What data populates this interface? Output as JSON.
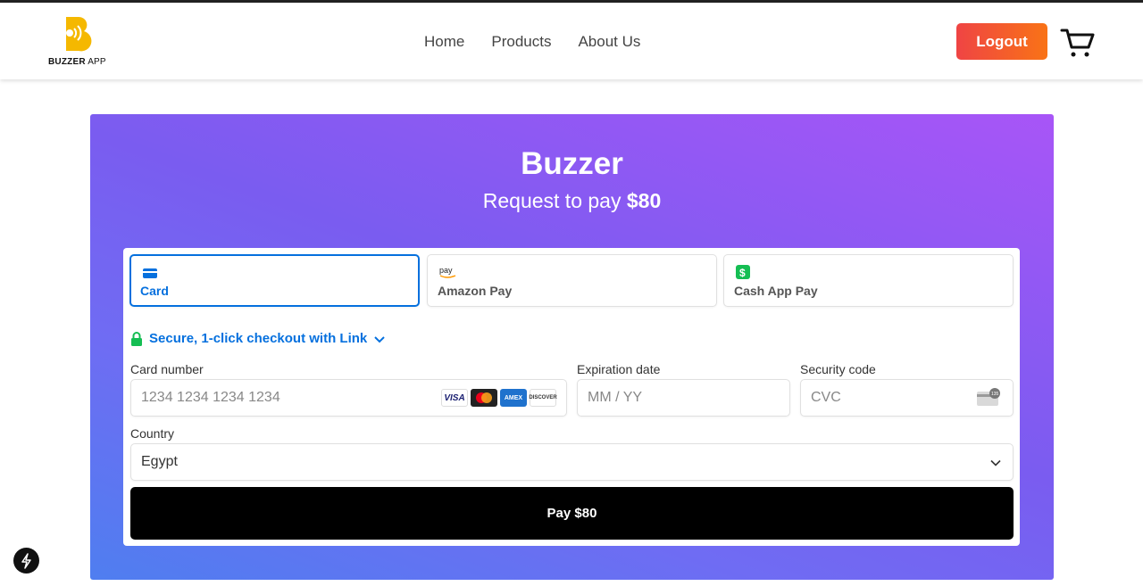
{
  "header": {
    "logo_text_bold": "BUZZER",
    "logo_text_light": " APP",
    "nav": [
      "Home",
      "Products",
      "About Us"
    ],
    "logout_label": "Logout"
  },
  "hero": {
    "title": "Buzzer",
    "request_prefix": "Request to pay ",
    "amount": "$80"
  },
  "payment": {
    "tabs": [
      {
        "label": "Card",
        "icon": "card-icon",
        "active": true
      },
      {
        "label": "Amazon Pay",
        "icon": "amazon-pay-icon",
        "active": false
      },
      {
        "label": "Cash App Pay",
        "icon": "cash-app-icon",
        "active": false
      }
    ],
    "link_text": "Secure, 1-click checkout with Link",
    "card_number_label": "Card number",
    "card_number_placeholder": "1234 1234 1234 1234",
    "card_brands": [
      "VISA",
      "Mastercard",
      "AMEX",
      "DISCOVER"
    ],
    "expiry_label": "Expiration date",
    "expiry_placeholder": "MM / YY",
    "cvc_label": "Security code",
    "cvc_placeholder": "CVC",
    "country_label": "Country",
    "country_value": "Egypt",
    "pay_label": "Pay $80"
  },
  "colors": {
    "accent": "#0570de",
    "logout_start": "#ef4444",
    "logout_end": "#f97316",
    "logo_yellow": "#f5b800",
    "link_green": "#15be53"
  }
}
